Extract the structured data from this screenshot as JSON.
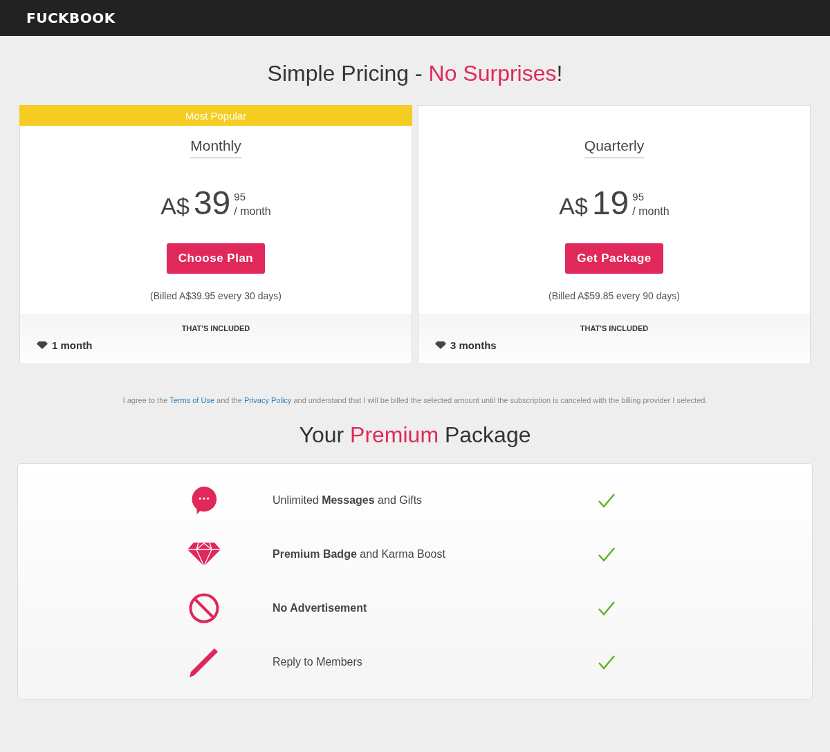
{
  "header": {
    "logo": "FUCKBOOK"
  },
  "title": {
    "before": "Simple Pricing - ",
    "accent": "No Surprises",
    "after": "!"
  },
  "plans": [
    {
      "badge": "Most Popular",
      "name": "Monthly",
      "currency": "A$",
      "whole": "39",
      "cents": "95",
      "period": "/ month",
      "button": "Choose Plan",
      "billing": "(Billed A$39.95 every 30 days)",
      "included_label": "THAT'S INCLUDED",
      "included": "1 month"
    },
    {
      "name": "Quarterly",
      "currency": "A$",
      "whole": "19",
      "cents": "95",
      "period": "/ month",
      "button": "Get Package",
      "billing": "(Billed A$59.85 every 90 days)",
      "included_label": "THAT'S INCLUDED",
      "included": "3 months"
    }
  ],
  "terms": [
    {
      "kind": "text",
      "text": "I agree to the"
    },
    {
      "kind": "link",
      "text": "Terms of Use"
    },
    {
      "kind": "text",
      "text": "and the"
    },
    {
      "kind": "link",
      "text": "Privacy Policy"
    },
    {
      "kind": "text",
      "text": "and understand that I will be billed the selected amount until the subscription is canceled with the billing provider I selected."
    }
  ],
  "package_title": {
    "before": "Your ",
    "accent": "Premium",
    "after": " Package"
  },
  "features": [
    {
      "kind": "message",
      "text": "Unlimited **Messages** and Gifts",
      "included": true
    },
    {
      "kind": "gem",
      "text": "**Premium Badge** and Karma Boost",
      "included": true
    },
    {
      "kind": "no-ads",
      "text": "**No Advertisement**",
      "included": true
    },
    {
      "kind": "pencil",
      "text": "Reply to Members",
      "included": true
    }
  ]
}
